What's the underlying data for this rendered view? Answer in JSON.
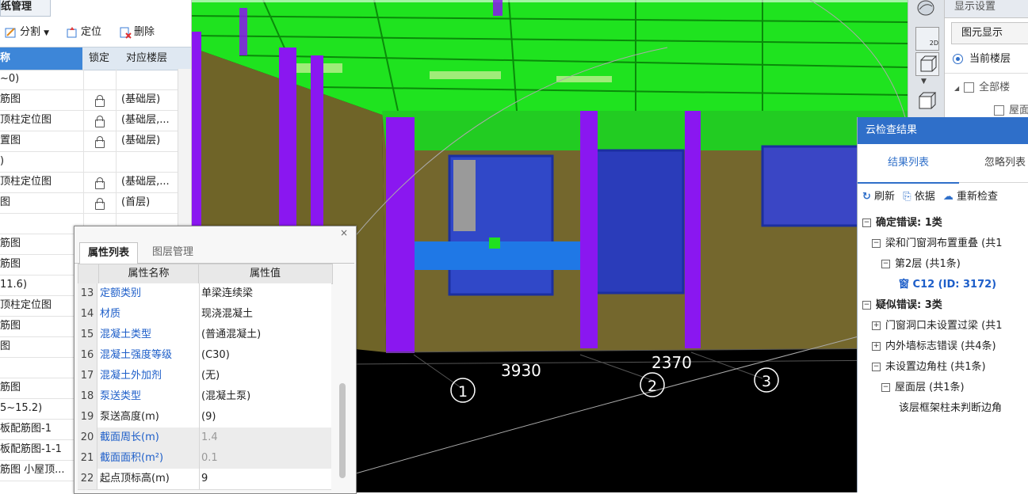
{
  "left_panel": {
    "title": "纸管理",
    "toolbar": {
      "split": "分割",
      "locate": "定位",
      "delete": "删除"
    },
    "headers": {
      "name": "称",
      "lock": "锁定",
      "floor": "对应楼层"
    },
    "rows": [
      {
        "name": "~0)",
        "locked": false,
        "floor": ""
      },
      {
        "name": "筋图",
        "locked": true,
        "floor": "(基础层)"
      },
      {
        "name": "顶柱定位图",
        "locked": true,
        "floor": "(基础层,..."
      },
      {
        "name": "置图",
        "locked": true,
        "floor": "(基础层)"
      },
      {
        "name": ")",
        "locked": false,
        "floor": ""
      },
      {
        "name": "顶柱定位图",
        "locked": true,
        "floor": "(基础层,..."
      },
      {
        "name": "图",
        "locked": true,
        "floor": "(首层)"
      },
      {
        "name": "",
        "locked": false,
        "floor": ""
      },
      {
        "name": "筋图",
        "locked": false,
        "floor": ""
      },
      {
        "name": "筋图",
        "locked": false,
        "floor": ""
      },
      {
        "name": "11.6)",
        "locked": false,
        "floor": ""
      },
      {
        "name": "顶柱定位图",
        "locked": false,
        "floor": ""
      },
      {
        "name": "筋图",
        "locked": false,
        "floor": ""
      },
      {
        "name": "图",
        "locked": false,
        "floor": ""
      },
      {
        "name": "",
        "locked": false,
        "floor": ""
      },
      {
        "name": "筋图",
        "locked": false,
        "floor": ""
      },
      {
        "name": "5~15.2)",
        "locked": false,
        "floor": ""
      },
      {
        "name": "板配筋图-1",
        "locked": false,
        "floor": ""
      },
      {
        "name": "板配筋图-1-1",
        "locked": false,
        "floor": ""
      },
      {
        "name": "筋图  小屋顶...",
        "locked": false,
        "floor": ""
      }
    ]
  },
  "properties_dialog": {
    "tabs": [
      "属性列表",
      "图层管理"
    ],
    "close": "×",
    "headers": {
      "name": "属性名称",
      "value": "属性值"
    },
    "rows": [
      {
        "index": "13",
        "name": "定额类别",
        "value": "单梁连续梁",
        "blue": true,
        "gray": false
      },
      {
        "index": "14",
        "name": "材质",
        "value": "现浇混凝土",
        "blue": true,
        "gray": false
      },
      {
        "index": "15",
        "name": "混凝土类型",
        "value": "(普通混凝土)",
        "blue": true,
        "gray": false
      },
      {
        "index": "16",
        "name": "混凝土强度等级",
        "value": "(C30)",
        "blue": true,
        "gray": false
      },
      {
        "index": "17",
        "name": "混凝土外加剂",
        "value": "(无)",
        "blue": true,
        "gray": false
      },
      {
        "index": "18",
        "name": "泵送类型",
        "value": "(混凝土泵)",
        "blue": true,
        "gray": false
      },
      {
        "index": "19",
        "name": "泵送高度(m)",
        "value": "(9)",
        "blue": false,
        "gray": false
      },
      {
        "index": "20",
        "name": "截面周长(m)",
        "value": "1.4",
        "blue": true,
        "gray": true
      },
      {
        "index": "21",
        "name": "截面面积(m²)",
        "value": "0.1",
        "blue": true,
        "gray": true
      },
      {
        "index": "22",
        "name": "起点顶标高(m)",
        "value": "9",
        "blue": false,
        "gray": false
      }
    ]
  },
  "viewport": {
    "dimensions": [
      "3930",
      "2370"
    ],
    "axis_labels": [
      "1",
      "2",
      "3"
    ]
  },
  "view_toolbar": {
    "btn_2d": "2D"
  },
  "display_settings": {
    "title": "显示设置",
    "tab": "图元显示",
    "current_floor": "当前楼层",
    "all_floors": "全部楼",
    "roof": "屋面"
  },
  "cloud_check": {
    "title": "云检查结果",
    "tabs": [
      "结果列表",
      "忽略列表"
    ],
    "actions": {
      "refresh": "刷新",
      "basis": "依据",
      "recheck": "重新检查"
    },
    "tree": [
      {
        "level": 0,
        "box": "−",
        "text": "确定错误: 1类",
        "bold": true
      },
      {
        "level": 1,
        "box": "−",
        "text": "梁和门窗洞布置重叠 (共1",
        "bold": false
      },
      {
        "level": 2,
        "box": "−",
        "text": "第2层 (共1条)",
        "bold": false
      },
      {
        "level": 3,
        "box": "",
        "text": "窗 C12 (ID: 3172)",
        "bold": true,
        "link": true
      },
      {
        "level": 0,
        "box": "−",
        "text": "疑似错误: 3类",
        "bold": true
      },
      {
        "level": 1,
        "box": "+",
        "text": "门窗洞口未设置过梁 (共1",
        "bold": false
      },
      {
        "level": 1,
        "box": "+",
        "text": "内外墙标志错误 (共4条)",
        "bold": false
      },
      {
        "level": 1,
        "box": "−",
        "text": "未设置边角柱 (共1条)",
        "bold": false
      },
      {
        "level": 2,
        "box": "−",
        "text": "屋面层 (共1条)",
        "bold": false
      },
      {
        "level": 3,
        "box": "",
        "text": "该层框架柱未判断边角",
        "bold": false
      }
    ]
  },
  "colors": {
    "accent": "#3d86d8",
    "slab": "#1fe31f",
    "column": "#8a17f0",
    "wall": "#7a6a2c",
    "beam": "#1f78e6",
    "cloud_title": "#2f6fc9"
  }
}
